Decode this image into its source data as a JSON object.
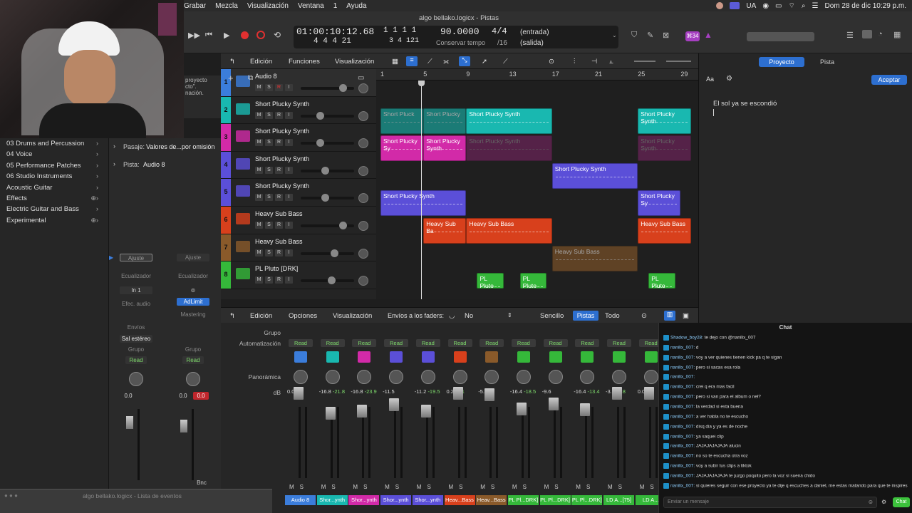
{
  "menubar": {
    "items": [
      "Grabar",
      "Mezcla",
      "Visualización",
      "Ventana",
      "1",
      "Ayuda"
    ],
    "lang": "UA",
    "datetime": "Dom 28 de dic  10:29 p.m."
  },
  "window": {
    "title": "algo bellako.logicx - Pistas"
  },
  "lcd": {
    "time": "01:00:10:12.68",
    "bars_top": "1   1   1   1",
    "bars_bottom": "4   4   4   21",
    "bars_bottom2": "3   4  121",
    "tempo": "90.0000",
    "tempo_label": "Conservar tempo",
    "sig": "4/4",
    "sig2": "/16",
    "in": "(entrada)",
    "out": "(salida)"
  },
  "toolbar_badge": "⌘34",
  "library": {
    "items": [
      "03 Drums and Percussion",
      "04 Voice",
      "05 Performance Patches",
      "06 Studio Instruments",
      "Acoustic Guitar",
      "Effects",
      "Electric Guitar and Bass",
      "Experimental"
    ]
  },
  "inspector": {
    "pasaje_label": "Pasaje:",
    "pasaje_value": "Valores de...por omisión",
    "pista_label": "Pista:",
    "pista_value": "Audio 8",
    "strip1": {
      "ajuste": "Ajuste",
      "eq": "Ecualizador",
      "in": "In 1",
      "fx": "Efec. audio",
      "envios": "Envíos",
      "out": "Sal estéreo",
      "grupo": "Grupo",
      "read": "Read",
      "vol": "0.0"
    },
    "strip2": {
      "ajuste": "Ajuste",
      "eq": "Ecualizador",
      "plugin": "AdLimit",
      "master": "Mastering",
      "grupo": "Grupo",
      "read": "Read",
      "vol": "0.0",
      "peak": "0.0",
      "bnc": "Bnc"
    },
    "note_line1": "proyecto",
    "note_line2": "cto\".",
    "note_line3": "nación."
  },
  "arrange_menu": {
    "edicion": "Edición",
    "funciones": "Funciones",
    "visualizacion": "Visualización"
  },
  "ruler": [
    "1",
    "5",
    "9",
    "13",
    "17",
    "21",
    "25",
    "29"
  ],
  "tracks": [
    {
      "num": "1",
      "name": "Audio 8",
      "color": "#3b7ddb",
      "rec": true
    },
    {
      "num": "2",
      "name": "Short Plucky Synth",
      "color": "#19b8b0",
      "rec": false
    },
    {
      "num": "3",
      "name": "Short Plucky Synth",
      "color": "#d22aa8",
      "rec": false
    },
    {
      "num": "4",
      "name": "Short Plucky Synth",
      "color": "#5b4fd8",
      "rec": false
    },
    {
      "num": "5",
      "name": "Short Plucky Synth",
      "color": "#5b4fd8",
      "rec": false
    },
    {
      "num": "6",
      "name": "Heavy Sub Bass",
      "color": "#d8401c",
      "rec": false
    },
    {
      "num": "7",
      "name": "Heavy Sub Bass",
      "color": "#8a5a2a",
      "rec": false
    },
    {
      "num": "8",
      "name": "PL Pluto [DRK]",
      "color": "#35b83a",
      "rec": false
    }
  ],
  "msr": {
    "m": "M",
    "s": "S",
    "r": "R",
    "i": "I"
  },
  "regions": {
    "sps": "Short Plucky Synth",
    "spl": "Short Pluck",
    "spl2": "Short Plucky",
    "spsy": "Short Plucky Sy",
    "spsyn": "Short Plucky Synth",
    "hsb": "Heavy Sub Bass",
    "hsba": "Heavy Sub Ba",
    "plp": "PL Pluto"
  },
  "rightpanel": {
    "tab1": "Proyecto",
    "tab2": "Pista",
    "aa": "Aa",
    "accept": "Aceptar",
    "note": "El sol ya se escondió"
  },
  "mixerbar": {
    "edicion": "Edición",
    "opciones": "Opciones",
    "visualizacion": "Visualización",
    "envios": "Envíos a los faders:",
    "no": "No",
    "sencillo": "Sencillo",
    "pistas": "Pistas",
    "todo": "Todo"
  },
  "mixer_labels": {
    "grupo": "Grupo",
    "auto": "Automatización",
    "pan": "Panorámica",
    "db": "dB"
  },
  "strips": [
    {
      "name": "Audio 8",
      "color": "#3b7ddb",
      "db": "0.0",
      "peak": "",
      "vol": "0.0"
    },
    {
      "name": "Shor...ynth",
      "color": "#19b8b0",
      "db": "-16.8",
      "peak": "-21.8"
    },
    {
      "name": "Shor...ynth",
      "color": "#d22aa8",
      "db": "-16.8",
      "peak": "-23.9"
    },
    {
      "name": "Shor...ynth",
      "color": "#5b4fd8",
      "db": "-11.5",
      "peak": ""
    },
    {
      "name": "Shor...ynth",
      "color": "#5b4fd8",
      "db": "-11.2",
      "peak": "-19.5"
    },
    {
      "name": "Heav...Bass",
      "color": "#d8401c",
      "db": "0.2",
      "peak": "-4.1"
    },
    {
      "name": "Heav...Bass",
      "color": "#8a5a2a",
      "db": "-5.0",
      "peak": ""
    },
    {
      "name": "PL Pl...DRK]",
      "color": "#35b83a",
      "db": "-16.4",
      "peak": "-18.5"
    },
    {
      "name": "PL Pl...DRK]",
      "color": "#35b83a",
      "db": "-9.6",
      "peak": ""
    },
    {
      "name": "PL Pl...DRK]",
      "color": "#35b83a",
      "db": "-16.4",
      "peak": "-13.4"
    },
    {
      "name": "LD A...[75]",
      "color": "#35b83a",
      "db": "-3.6",
      "peak": "-9.8"
    },
    {
      "name": "LD A...",
      "color": "#35b83a",
      "db": "0.0",
      "peak": ""
    }
  ],
  "read_label": "Read",
  "chat": {
    "title": "Chat",
    "messages": [
      {
        "user": "Shadow_boy28:",
        "text": "te dejo con @nanilix_007"
      },
      {
        "user": "nanilix_007:",
        "text": "d"
      },
      {
        "user": "nanilix_007:",
        "text": "voy a ver quienes tienen kick pa q te sigan"
      },
      {
        "user": "nanilix_007:",
        "text": "pero si sacas esa rola"
      },
      {
        "user": "nanilix_007:",
        "text": ""
      },
      {
        "user": "nanilix_007:",
        "text": "crei q era mas facil"
      },
      {
        "user": "nanilix_007:",
        "text": "pero si van para el album o nel?"
      },
      {
        "user": "nanilix_007:",
        "text": "la verdad si esta buena"
      },
      {
        "user": "nanilix_007:",
        "text": "a ver habla no te escucho"
      },
      {
        "user": "nanilix_007:",
        "text": "disq dia y ya es de noche"
      },
      {
        "user": "nanilix_007:",
        "text": "ya saquei clip"
      },
      {
        "user": "nanilix_007:",
        "text": "JAJAJAJAJAJA alucin"
      },
      {
        "user": "nanilix_007:",
        "text": "no so te escucha otra voz"
      },
      {
        "user": "nanilix_007:",
        "text": "voy a subir tus clips a tiktok"
      },
      {
        "user": "nanilix_007:",
        "text": "JAJAJAJAJAJA te juzgo poquito pero la voz si suena chido"
      },
      {
        "user": "nanilix_007:",
        "text": "si quieres seguir con ese proyecto ya te dije q escuches a daniel, me estas matando para que te inspires"
      }
    ],
    "placeholder": "Enviar un mensaje",
    "send": "Chat"
  },
  "eventlist": "algo bellako.logicx - Lista de eventos"
}
